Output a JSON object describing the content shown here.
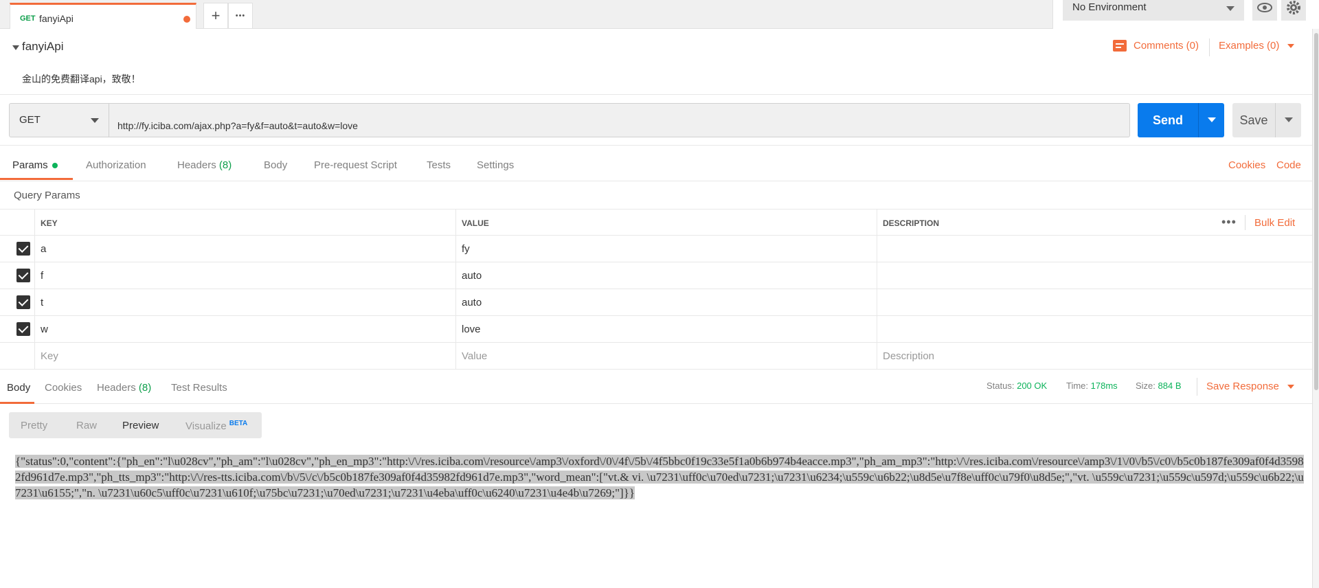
{
  "tab": {
    "method": "GET",
    "name": "fanyiApi",
    "add_label": "+",
    "more_label": "•••"
  },
  "environment": {
    "selected": "No Environment"
  },
  "request": {
    "title": "fanyiApi",
    "description": "金山的免费翻译api，致敬！",
    "comments_label": "Comments (0)",
    "examples_label": "Examples (0)",
    "method": "GET",
    "url": "http://fy.iciba.com/ajax.php?a=fy&f=auto&t=auto&w=love",
    "send_label": "Send",
    "save_label": "Save"
  },
  "request_tabs": {
    "params": "Params",
    "authorization": "Authorization",
    "headers": "Headers",
    "headers_count": "(8)",
    "body": "Body",
    "prerequest": "Pre-request Script",
    "tests": "Tests",
    "settings": "Settings",
    "cookies": "Cookies",
    "code": "Code"
  },
  "query_params": {
    "label": "Query Params",
    "columns": {
      "key": "KEY",
      "value": "VALUE",
      "description": "DESCRIPTION"
    },
    "more_label": "•••",
    "bulk_edit": "Bulk Edit",
    "rows": [
      {
        "key": "a",
        "value": "fy",
        "description": ""
      },
      {
        "key": "f",
        "value": "auto",
        "description": ""
      },
      {
        "key": "t",
        "value": "auto",
        "description": ""
      },
      {
        "key": "w",
        "value": "love",
        "description": ""
      }
    ],
    "placeholder": {
      "key": "Key",
      "value": "Value",
      "description": "Description"
    }
  },
  "response": {
    "tabs": {
      "body": "Body",
      "cookies": "Cookies",
      "headers": "Headers",
      "headers_count": "(8)",
      "test_results": "Test Results"
    },
    "status_label": "Status:",
    "status_value": "200 OK",
    "time_label": "Time:",
    "time_value": "178ms",
    "size_label": "Size:",
    "size_value": "884 B",
    "save_response": "Save Response",
    "view_tabs": {
      "pretty": "Pretty",
      "raw": "Raw",
      "preview": "Preview",
      "visualize": "Visualize",
      "beta": "BETA"
    },
    "body_text": "{\"status\":0,\"content\":{\"ph_en\":\"l\\u028cv\",\"ph_am\":\"l\\u028cv\",\"ph_en_mp3\":\"http:\\/\\/res.iciba.com\\/resource\\/amp3\\/oxford\\/0\\/4f\\/5b\\/4f5bbc0f19c33e5f1a0b6b974b4eacce.mp3\",\"ph_am_mp3\":\"http:\\/\\/res.iciba.com\\/resource\\/amp3\\/1\\/0\\/b5\\/c0\\/b5c0b187fe309af0f4d35982fd961d7e.mp3\",\"ph_tts_mp3\":\"http:\\/\\/res-tts.iciba.com\\/b\\/5\\/c\\/b5c0b187fe309af0f4d35982fd961d7e.mp3\",\"word_mean\":[\"vt.& vi. \\u7231\\uff0c\\u70ed\\u7231;\\u7231\\u6234;\\u559c\\u6b22;\\u8d5e\\u7f8e\\uff0c\\u79f0\\u8d5e;\",\"vt. \\u559c\\u7231;\\u559c\\u597d;\\u559c\\u6b22;\\u7231\\u6155;\",\"n. \\u7231\\u60c5\\uff0c\\u7231\\u610f;\\u75bc\\u7231;\\u70ed\\u7231;\\u7231\\u4eba\\uff0c\\u6240\\u7231\\u4e4b\\u7269;\"]}}"
  },
  "colors": {
    "accent": "#f26b3a",
    "send": "#097bed",
    "ok": "#0cb35a",
    "get": "#0c9e4a"
  }
}
